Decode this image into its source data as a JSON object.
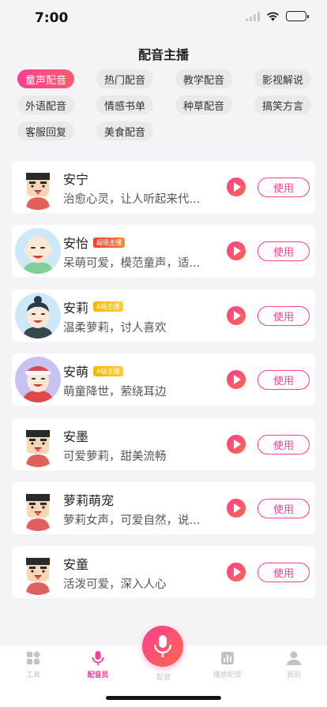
{
  "status": {
    "time": "7:00"
  },
  "header": {
    "title": "配音主播"
  },
  "tags": [
    "童声配音",
    "热门配音",
    "教学配音",
    "影视解说",
    "外语配音",
    "情感书单",
    "种草配音",
    "搞笑方言",
    "客服回复",
    "美食配音"
  ],
  "active_tag": "童声配音",
  "voices": [
    {
      "name": "安宁",
      "badge": "",
      "desc": "治愈心灵，让人听起来代...",
      "avatar": "boy-avatar",
      "use_label": "使用"
    },
    {
      "name": "安怡",
      "badge": "超级主播",
      "badge_color": "#f23b3b",
      "desc": "呆萌可爱，模范童声，适...",
      "avatar": "bald-kid-avatar",
      "use_label": "使用"
    },
    {
      "name": "安莉",
      "badge": "A级主播",
      "badge_color": "#ffb300",
      "desc": "温柔萝莉，讨人喜欢",
      "avatar": "bun-girl-avatar",
      "use_label": "使用"
    },
    {
      "name": "安萌",
      "badge": "A级主播",
      "badge_color": "#ffb300",
      "desc": "萌童降世，萦绕耳边",
      "avatar": "santa-kid-avatar",
      "use_label": "使用"
    },
    {
      "name": "安墨",
      "badge": "",
      "desc": "可爱萝莉，甜美流畅",
      "avatar": "boy-avatar",
      "use_label": "使用"
    },
    {
      "name": "萝莉萌宠",
      "badge": "",
      "desc": "萝莉女声，可爱自然，说...",
      "avatar": "boy-avatar",
      "use_label": "使用"
    },
    {
      "name": "安童",
      "badge": "",
      "desc": "活泼可爱，深入人心",
      "avatar": "boy-avatar",
      "use_label": "使用"
    }
  ],
  "tabbar": {
    "tools": "工具",
    "voice_actors": "配音员",
    "dub": "配音",
    "broadcast": "播放配音",
    "mine": "我的"
  },
  "colors": {
    "accent": "#ff3d93",
    "accent2": "#ff6a4a",
    "badge_super": "#f23b3b",
    "badge_a": "#ffb300"
  }
}
